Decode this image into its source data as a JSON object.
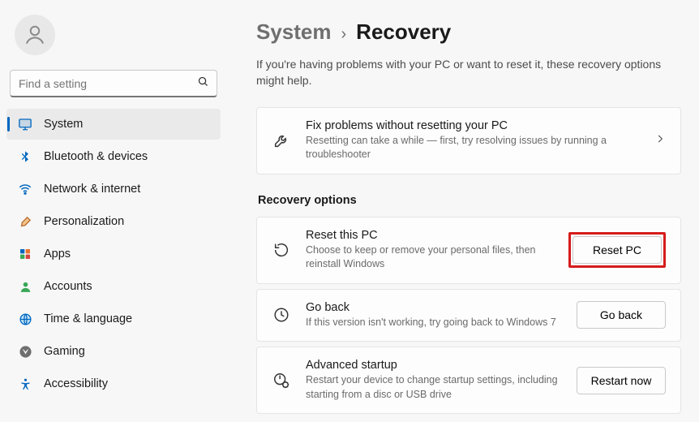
{
  "colors": {
    "accent": "#0067c0",
    "highlight": "#d61b1b"
  },
  "search": {
    "placeholder": "Find a setting"
  },
  "nav": {
    "items": [
      {
        "id": "system",
        "label": "System",
        "active": true
      },
      {
        "id": "bluetooth",
        "label": "Bluetooth & devices"
      },
      {
        "id": "network",
        "label": "Network & internet"
      },
      {
        "id": "personalization",
        "label": "Personalization"
      },
      {
        "id": "apps",
        "label": "Apps"
      },
      {
        "id": "accounts",
        "label": "Accounts"
      },
      {
        "id": "time",
        "label": "Time & language"
      },
      {
        "id": "gaming",
        "label": "Gaming"
      },
      {
        "id": "accessibility",
        "label": "Accessibility"
      }
    ]
  },
  "breadcrumb": {
    "parent": "System",
    "current": "Recovery"
  },
  "intro": "If you're having problems with your PC or want to reset it, these recovery options might help.",
  "fix_card": {
    "title": "Fix problems without resetting your PC",
    "desc": "Resetting can take a while — first, try resolving issues by running a troubleshooter"
  },
  "recovery_header": "Recovery options",
  "reset_card": {
    "title": "Reset this PC",
    "desc": "Choose to keep or remove your personal files, then reinstall Windows",
    "button": "Reset PC"
  },
  "goback_card": {
    "title": "Go back",
    "desc": "If this version isn't working, try going back to Windows 7",
    "button": "Go back"
  },
  "advanced_card": {
    "title": "Advanced startup",
    "desc": "Restart your device to change startup settings, including starting from a disc or USB drive",
    "button": "Restart now"
  }
}
